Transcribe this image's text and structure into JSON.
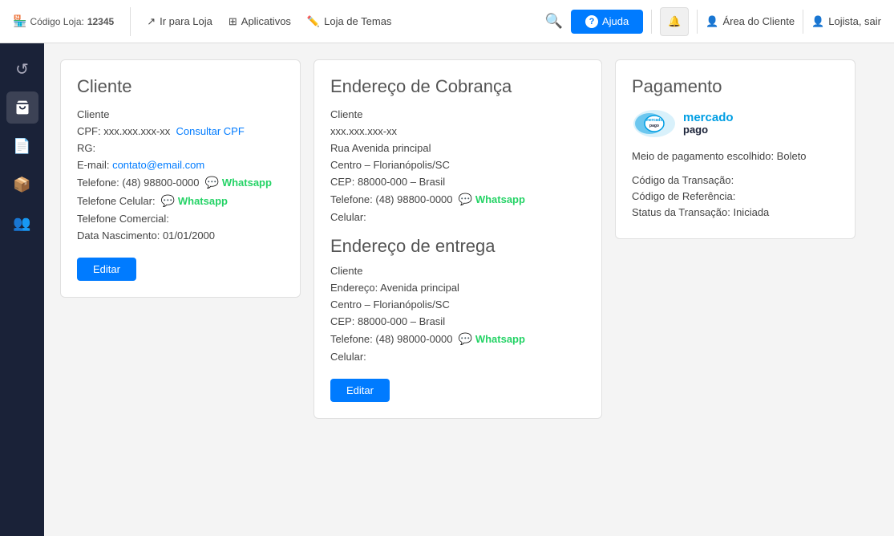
{
  "topnav": {
    "store_code_label": "Código Loja:",
    "store_code": "12345",
    "link_ir_loja": "Ir para Loja",
    "link_aplicativos": "Aplicativos",
    "link_loja_temas": "Loja de Temas",
    "btn_ajuda": "Ajuda",
    "btn_area_cliente": "Área do Cliente",
    "btn_lojista": "Lojista, sair"
  },
  "sidebar": {
    "items": [
      {
        "name": "refresh-icon",
        "icon": "↺",
        "active": false
      },
      {
        "name": "cart-icon",
        "icon": "🛒",
        "active": true
      },
      {
        "name": "document-icon",
        "icon": "📄",
        "active": false
      },
      {
        "name": "box-icon",
        "icon": "📦",
        "active": false
      },
      {
        "name": "users-icon",
        "icon": "👥",
        "active": false
      }
    ]
  },
  "cliente_card": {
    "title": "Cliente",
    "cliente_label": "Cliente",
    "cpf_label": "CPF:",
    "cpf_value": "xxx.xxx.xxx-xx",
    "consultar_cpf": "Consultar CPF",
    "rg_label": "RG:",
    "email_label": "E-mail:",
    "email_value": "contato@email.com",
    "telefone_label": "Telefone:",
    "telefone_value": "(48) 98800-0000",
    "whatsapp1": "Whatsapp",
    "telefone_celular_label": "Telefone Celular:",
    "whatsapp2": "Whatsapp",
    "telefone_comercial_label": "Telefone Comercial:",
    "data_nascimento_label": "Data Nascimento:",
    "data_nascimento_value": "01/01/2000",
    "btn_editar": "Editar"
  },
  "endereco_cobranca": {
    "title": "Endereço de Cobrança",
    "cliente_label": "Cliente",
    "cpf_value": "xxx.xxx.xxx-xx",
    "rua": "Rua Avenida principal",
    "bairro_cidade": "Centro – Florianópolis/SC",
    "cep": "CEP: 88000-000 – Brasil",
    "telefone_label": "Telefone:",
    "telefone_value": "(48) 98800-0000",
    "whatsapp": "Whatsapp",
    "celular_label": "Celular:"
  },
  "endereco_entrega": {
    "title": "Endereço de entrega",
    "cliente_label": "Cliente",
    "endereco_label": "Endereço:",
    "endereco_value": "Avenida principal",
    "bairro_cidade": "Centro – Florianópolis/SC",
    "cep": "CEP: 88000-000 – Brasil",
    "telefone_label": "Telefone:",
    "telefone_value": "(48) 98000-0000",
    "whatsapp": "Whatsapp",
    "celular_label": "Celular:",
    "btn_editar": "Editar"
  },
  "pagamento": {
    "title": "Pagamento",
    "logo_line1": "mercado",
    "logo_line2": "pago",
    "meio_pagamento": "Meio de pagamento escolhido: Boleto",
    "codigo_transacao": "Código da Transação:",
    "codigo_referencia": "Código de Referência:",
    "status_transacao": "Status da Transação: Iniciada"
  }
}
